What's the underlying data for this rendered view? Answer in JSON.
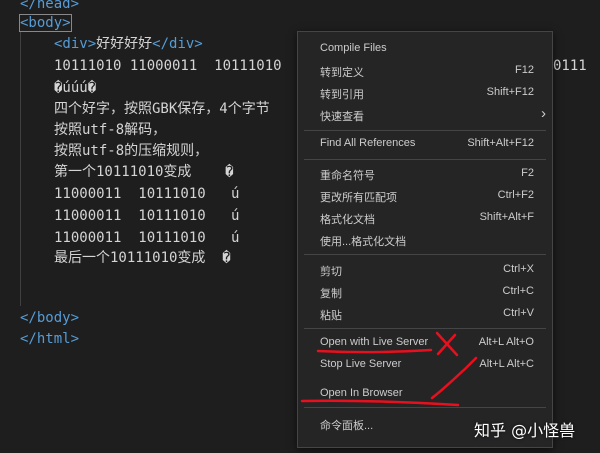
{
  "editor": {
    "lines": {
      "head_close": "</head>",
      "body_open": "<body>",
      "div_open": "<div>",
      "div_text": "好好好好",
      "div_close": "</div>",
      "bits": "10111010 11000011  10111010",
      "bits_clipped": "0111",
      "garbled": "�úúú�",
      "t1": "四个好字，按照GBK保存，4个字节",
      "t2": "按照utf-8解码，",
      "t3": "按照utf-8的压缩规则，",
      "t4": "第一个10111010变成    �",
      "b1": "11000011  10111010   ú",
      "b2": "11000011  10111010   ú",
      "b3": "11000011  10111010   ú",
      "t5": "最后一个10111010变成  �",
      "body_close": "</body>",
      "html_close": "</html>"
    }
  },
  "context_menu": {
    "items": [
      {
        "label": "Compile Files",
        "shortcut": ""
      },
      {
        "label": "转到定义",
        "shortcut": "F12"
      },
      {
        "label": "转到引用",
        "shortcut": "Shift+F12"
      },
      {
        "label": "快速查看",
        "shortcut": ""
      },
      {
        "label": "Find All References",
        "shortcut": "Shift+Alt+F12"
      },
      {
        "label": "重命名符号",
        "shortcut": "F2"
      },
      {
        "label": "更改所有匹配项",
        "shortcut": "Ctrl+F2"
      },
      {
        "label": "格式化文档",
        "shortcut": "Shift+Alt+F"
      },
      {
        "label": "使用...格式化文档",
        "shortcut": ""
      },
      {
        "label": "剪切",
        "shortcut": "Ctrl+X"
      },
      {
        "label": "复制",
        "shortcut": "Ctrl+C"
      },
      {
        "label": "粘贴",
        "shortcut": "Ctrl+V"
      },
      {
        "label": "Open with Live Server",
        "shortcut": "Alt+L Alt+O"
      },
      {
        "label": "Stop Live Server",
        "shortcut": "Alt+L Alt+C"
      },
      {
        "label": "Open In Browser",
        "shortcut": ""
      },
      {
        "label": "命令面板...",
        "shortcut": ""
      }
    ],
    "submenu_arrow": "›"
  },
  "watermark": "知乎 @小怪兽",
  "colors": {
    "editor_bg": "#1e1e1e",
    "tag": "#569cd6",
    "text": "#d4d4d4",
    "menu_bg": "#252526",
    "annotation": "#e8101e"
  }
}
